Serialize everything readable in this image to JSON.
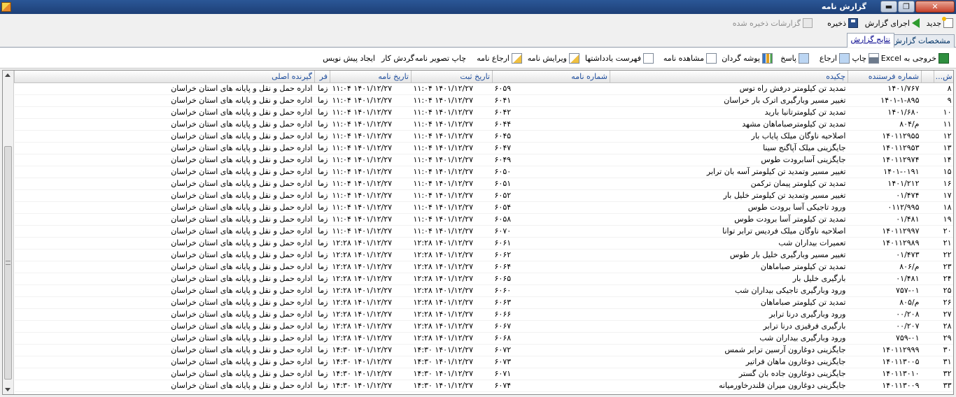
{
  "window": {
    "title": "گزارش نامه",
    "min_label": "▬",
    "max_label": "❐",
    "close_label": "✕"
  },
  "toolbar": {
    "new_label": "جدید",
    "run_label": "اجرای گزارش",
    "save_label": "ذخیره",
    "saved_reports_label": "گزارشات ذخیره شده"
  },
  "tabs": [
    {
      "label": "مشخصات گزارش"
    },
    {
      "label": "نتایج گزارش"
    }
  ],
  "actions": [
    {
      "label": "خروجی به Excel",
      "icon": "excel-icon"
    },
    {
      "label": "چاپ",
      "icon": "print-icon"
    },
    {
      "label": "ارجاع",
      "icon": "refer-icon"
    },
    {
      "label": "پاسخ",
      "icon": "reply-icon"
    },
    {
      "label": "پوشه گردان",
      "icon": "folder-chart-icon"
    },
    {
      "label": "مشاهده نامه",
      "icon": "view-letter-icon"
    },
    {
      "label": "فهرست یادداشتها",
      "icon": "notes-list-icon"
    },
    {
      "label": "ویرایش نامه",
      "icon": "edit-letter-icon"
    },
    {
      "label": "ارجاع نامه",
      "icon": ""
    },
    {
      "label": "چاپ تصویر نامه",
      "icon": ""
    },
    {
      "label": "گردش کار",
      "icon": ""
    },
    {
      "label": "ایجاد پیش نویس",
      "icon": ""
    }
  ],
  "table": {
    "columns": [
      "ش...",
      "",
      "شماره فرستنده",
      "چکیده",
      "شماره نامه",
      "تاریخ ثبت",
      "تاریخ نامه",
      "فر",
      "گیرنده اصلی"
    ],
    "rows": [
      [
        "۸",
        "۱۴۰۱/۷۶۷",
        "تمدید تن کیلومتر درفش راه توس",
        "۶۰۵۹",
        "۱۴۰۱/۱۲/۲۷ ۱۱:۰۴",
        "۱۴۰۱/۱۲/۲۷ ۱۱:۰۴",
        "زما",
        "اداره حمل و نقل و پایانه های استان خراسان"
      ],
      [
        "۹",
        "۱۴۰۱-۱-۸۹۵",
        "تغییر مسیر وبارگیری اترک بار خراسان",
        "۶۰۴۱",
        "۱۴۰۱/۱۲/۲۷ ۱۱:۰۴",
        "۱۴۰۱/۱۲/۲۷ ۱۱:۰۴",
        "زما",
        "اداره حمل و نقل و پایانه های استان خراسان"
      ],
      [
        "۱۰",
        "۱۴۰۱/۶۸۰",
        "تمدید تن کیلومترتانیا بارید",
        "۶۰۴۲",
        "۱۴۰۱/۱۲/۲۷ ۱۱:۰۴",
        "۱۴۰۱/۱۲/۲۷ ۱۱:۰۴",
        "زما",
        "اداره حمل و نقل و پایانه های استان خراسان"
      ],
      [
        "۱۱",
        "م/۸۰۴",
        "تمدید تن کیلومترصباماهان مشهد",
        "۶۰۴۴",
        "۱۴۰۱/۱۲/۲۷ ۱۱:۰۴",
        "۱۴۰۱/۱۲/۲۷ ۱۱:۰۴",
        "زما",
        "اداره حمل و نقل و پایانه های استان خراسان"
      ],
      [
        "۱۲",
        "۱۴۰۱۱۲۹۵۵",
        "اصلاحیه ناوگان میلک پایاب بار",
        "۶۰۴۵",
        "۱۴۰۱/۱۲/۲۷ ۱۱:۰۴",
        "۱۴۰۱/۱۲/۲۷ ۱۱:۰۴",
        "زما",
        "اداره حمل و نقل و پایانه های استان خراسان"
      ],
      [
        "۱۳",
        "۱۴۰۱۱۲۹۵۳",
        "جایگزینی میلک آپاگنج سینا",
        "۶۰۴۷",
        "۱۴۰۱/۱۲/۲۷ ۱۱:۰۴",
        "۱۴۰۱/۱۲/۲۷ ۱۱:۰۴",
        "زما",
        "اداره حمل و نقل و پایانه های استان خراسان"
      ],
      [
        "۱۴",
        "۱۴۰۱۱۲۹۷۴",
        "جایگزینی آسابرودت طوس",
        "۶۰۴۹",
        "۱۴۰۱/۱۲/۲۷ ۱۱:۰۴",
        "۱۴۰۱/۱۲/۲۷ ۱۱:۰۴",
        "زما",
        "اداره حمل و نقل و پایانه های استان خراسان"
      ],
      [
        "۱۵",
        "۱۴۰۱-۰۱۹۱",
        "تغییر مسیر وتمدید تن کیلومتر آسه بان ترابر",
        "۶۰۵۰",
        "۱۴۰۱/۱۲/۲۷ ۱۱:۰۴",
        "۱۴۰۱/۱۲/۲۷ ۱۱:۰۴",
        "زما",
        "اداره حمل و نقل و پایانه های استان خراسان"
      ],
      [
        "۱۶",
        "۱۴۰۱/۲۱۲",
        "تمدید تن کیلومتر پیمان ترکمن",
        "۶۰۵۱",
        "۱۴۰۱/۱۲/۲۷ ۱۱:۰۴",
        "۱۴۰۱/۱۲/۲۷ ۱۱:۰۴",
        "زما",
        "اداره حمل و نقل و پایانه های استان خراسان"
      ],
      [
        "۱۷",
        "۰۱/۴۷۴",
        "تغییر مسیر وتمدید تن کیلومتر خلیل بار",
        "۶۰۵۲",
        "۱۴۰۱/۱۲/۲۷ ۱۱:۰۴",
        "۱۴۰۱/۱۲/۲۷ ۱۱:۰۴",
        "زما",
        "اداره حمل و نقل و پایانه های استان خراسان"
      ],
      [
        "۱۸",
        "۰۱۱۲/۹۹۵",
        "ورود تاجیکی آسا برودت طوس",
        "۶۰۵۴",
        "۱۴۰۱/۱۲/۲۷ ۱۱:۰۴",
        "۱۴۰۱/۱۲/۲۷ ۱۱:۰۴",
        "زما",
        "اداره حمل و نقل و پایانه های استان خراسان"
      ],
      [
        "۱۹",
        "۰۱/۴۸۱",
        "تمدید تن کیلومتر آسا برودت طوس",
        "۶۰۵۸",
        "۱۴۰۱/۱۲/۲۷ ۱۱:۰۴",
        "۱۴۰۱/۱۲/۲۷ ۱۱:۰۴",
        "زما",
        "اداره حمل و نقل و پایانه های استان خراسان"
      ],
      [
        "۲۰",
        "۱۴۰۱۱۲۹۹۷",
        "اصلاحیه ناوگان میلک فردیس ترابر توانا",
        "۶۰۷۰",
        "۱۴۰۱/۱۲/۲۷ ۱۱:۰۴",
        "۱۴۰۱/۱۲/۲۷ ۱۱:۰۴",
        "زما",
        "اداره حمل و نقل و پایانه های استان خراسان"
      ],
      [
        "۲۱",
        "۱۴۰۱۱۲۹۸۹",
        "تعمیرات بیداران شب",
        "۶۰۶۱",
        "۱۴۰۱/۱۲/۲۷ ۱۲:۲۸",
        "۱۴۰۱/۱۲/۲۷ ۱۲:۲۸",
        "زما",
        "اداره حمل و نقل و پایانه های استان خراسان"
      ],
      [
        "۲۲",
        "۰۱/۴۷۳",
        "تغییر مسیر وبارگیری خلیل بار طوس",
        "۶۰۶۲",
        "۱۴۰۱/۱۲/۲۷ ۱۲:۲۸",
        "۱۴۰۱/۱۲/۲۷ ۱۲:۲۸",
        "زما",
        "اداره حمل و نقل و پایانه های استان خراسان"
      ],
      [
        "۲۳",
        "م/۸۰۶",
        "تمدید تن کیلومتر صباماهان",
        "۶۰۶۴",
        "۱۴۰۱/۱۲/۲۷ ۱۲:۲۸",
        "۱۴۰۱/۱۲/۲۷ ۱۲:۲۸",
        "زما",
        "اداره حمل و نقل و پایانه های استان خراسان"
      ],
      [
        "۲۴",
        "۰۱/۴۸۱",
        "بارگیری خلیل بار",
        "۶۰۶۵",
        "۱۴۰۱/۱۲/۲۷ ۱۲:۲۸",
        "۱۴۰۱/۱۲/۲۷ ۱۲:۲۸",
        "زما",
        "اداره حمل و نقل و پایانه های استان خراسان"
      ],
      [
        "۲۵",
        "۷۵۷-۰۱",
        "ورود وبارگیری تاجیکی بیداران شب",
        "۶۰۶۰",
        "۱۴۰۱/۱۲/۲۷ ۱۲:۲۸",
        "۱۴۰۱/۱۲/۲۷ ۱۲:۲۸",
        "زما",
        "اداره حمل و نقل و پایانه های استان خراسان"
      ],
      [
        "۲۶",
        "م/۸۰۵",
        "تمدید تن کیلومتر صباماهان",
        "۶۰۶۳",
        "۱۴۰۱/۱۲/۲۷ ۱۲:۲۸",
        "۱۴۰۱/۱۲/۲۷ ۱۲:۲۸",
        "زما",
        "اداره حمل و نقل و پایانه های استان خراسان"
      ],
      [
        "۲۷",
        "۰۰/۲۰۸",
        "ورود وبارگیری درنا ترابر",
        "۶۰۶۶",
        "۱۴۰۱/۱۲/۲۷ ۱۲:۲۸",
        "۱۴۰۱/۱۲/۲۷ ۱۲:۲۸",
        "زما",
        "اداره حمل و نقل و پایانه های استان خراسان"
      ],
      [
        "۲۸",
        "۰۰/۲۰۷",
        "بارگیری فرقیزی درنا ترابر",
        "۶۰۶۷",
        "۱۴۰۱/۱۲/۲۷ ۱۲:۲۸",
        "۱۴۰۱/۱۲/۲۷ ۱۲:۲۸",
        "زما",
        "اداره حمل و نقل و پایانه های استان خراسان"
      ],
      [
        "۲۹",
        "۷۵۹-۰۱",
        "ورود وبارگیری بیداران شب",
        "۶۰۶۸",
        "۱۴۰۱/۱۲/۲۷ ۱۲:۲۸",
        "۱۴۰۱/۱۲/۲۷ ۱۲:۲۸",
        "زما",
        "اداره حمل و نقل و پایانه های استان خراسان"
      ],
      [
        "۳۰",
        "۱۴۰۱۱۲۹۹۹",
        "جایگزینی دوغارون آرسین ترابر شمس",
        "۶۰۷۲",
        "۱۴۰۱/۱۲/۲۷ ۱۴:۳۰",
        "۱۴۰۱/۱۲/۲۷ ۱۴:۳۰",
        "زما",
        "اداره حمل و نقل و پایانه های استان خراسان"
      ],
      [
        "۳۱",
        "۱۴۰۱۱۳۰۰۵",
        "جایگزینی دوغارون ماهان فراتیر",
        "۶۰۷۳",
        "۱۴۰۱/۱۲/۲۷ ۱۴:۳۰",
        "۱۴۰۱/۱۲/۲۷ ۱۴:۳۰",
        "زما",
        "اداره حمل و نقل و پایانه های استان خراسان"
      ],
      [
        "۳۲",
        "۱۴۰۱۱۳۰۱۰",
        "جایگزینی دوغارون جاده بان گستر",
        "۶۰۷۱",
        "۱۴۰۱/۱۲/۲۷ ۱۴:۳۰",
        "۱۴۰۱/۱۲/۲۷ ۱۴:۳۰",
        "زما",
        "اداره حمل و نقل و پایانه های استان خراسان"
      ],
      [
        "۳۳",
        "۱۴۰۱۱۳۰۰۹",
        "جایگزینی دوغارون میران قلندرخاورمیانه",
        "۶۰۷۴",
        "۱۴۰۱/۱۲/۲۷ ۱۴:۳۰",
        "۱۴۰۱/۱۲/۲۷ ۱۴:۳۰",
        "زما",
        "اداره حمل و نقل و پایانه های استان خراسان"
      ]
    ]
  }
}
